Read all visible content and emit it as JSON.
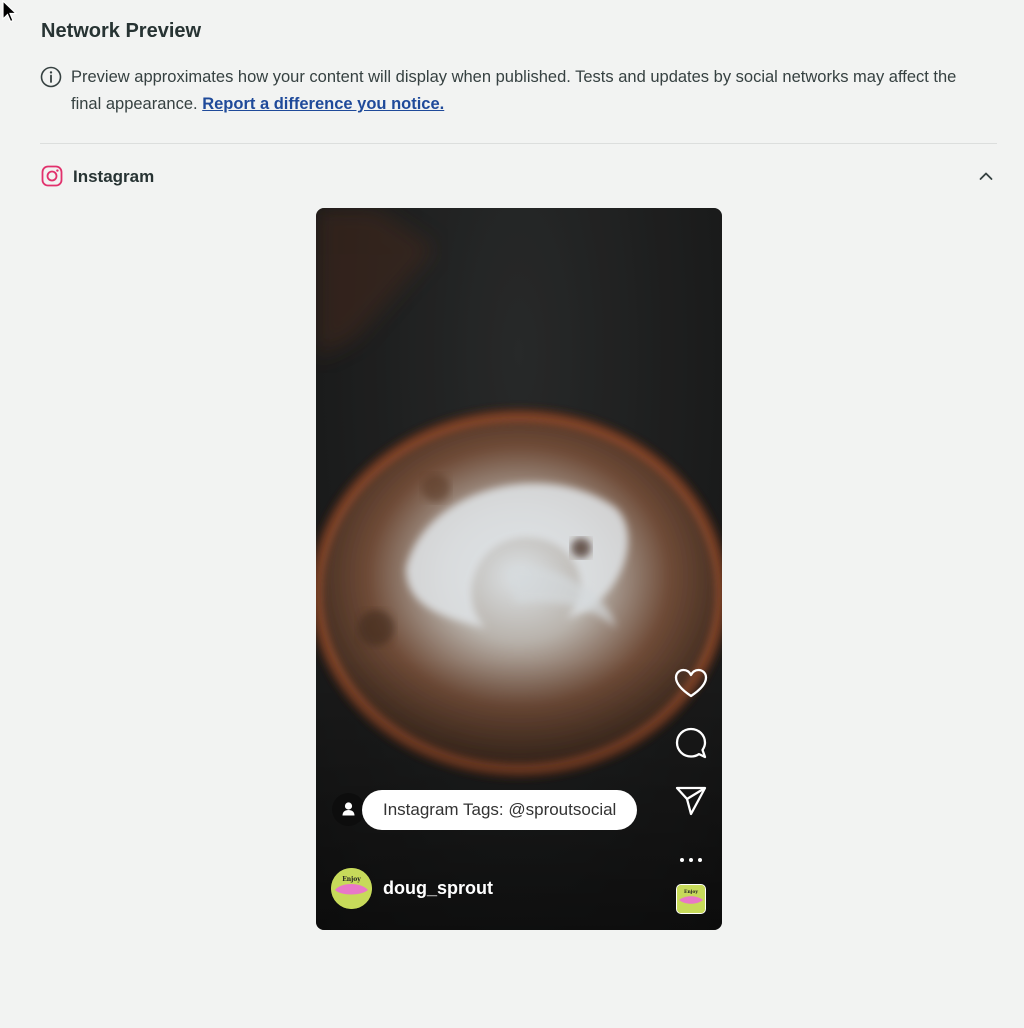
{
  "page": {
    "title": "Network Preview",
    "info_text": "Preview approximates how your content will display when published. Tests and updates by social networks may affect the final appearance.",
    "info_link": "Report a difference you notice."
  },
  "network": {
    "name": "Instagram",
    "expanded": true
  },
  "post": {
    "tag_text": "Instagram Tags: @sproutsocial",
    "username": "doug_sprout",
    "avatar_text": "Enjoy"
  },
  "icons": {
    "info": "info-circle-icon",
    "network": "instagram-icon",
    "collapse": "chevron-up-icon",
    "like": "heart-icon",
    "comment": "comment-bubble-icon",
    "share": "send-icon",
    "more": "ellipsis-icon",
    "tag_user": "user-icon"
  },
  "colors": {
    "background": "#f2f3f2",
    "link": "#1f4a9a",
    "instagram": "#e1306c",
    "avatar": "#c7da5a"
  }
}
